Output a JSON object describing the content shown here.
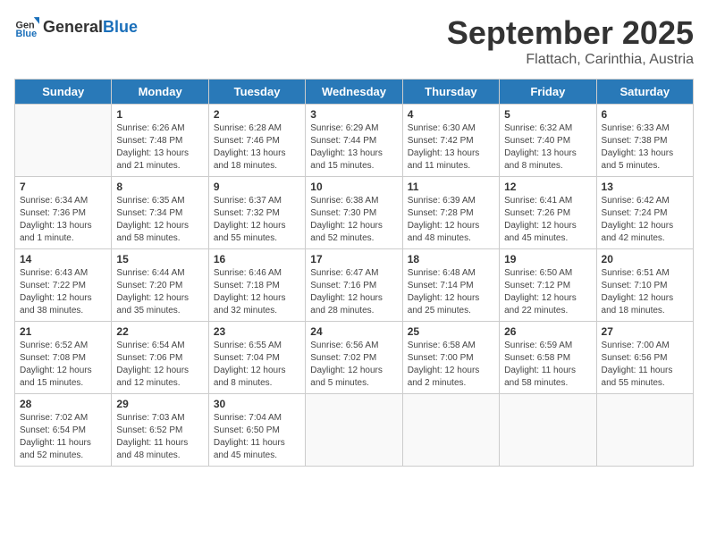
{
  "header": {
    "logo_general": "General",
    "logo_blue": "Blue",
    "month_year": "September 2025",
    "location": "Flattach, Carinthia, Austria"
  },
  "weekdays": [
    "Sunday",
    "Monday",
    "Tuesday",
    "Wednesday",
    "Thursday",
    "Friday",
    "Saturday"
  ],
  "weeks": [
    [
      {
        "day": "",
        "info": ""
      },
      {
        "day": "1",
        "info": "Sunrise: 6:26 AM\nSunset: 7:48 PM\nDaylight: 13 hours and 21 minutes."
      },
      {
        "day": "2",
        "info": "Sunrise: 6:28 AM\nSunset: 7:46 PM\nDaylight: 13 hours and 18 minutes."
      },
      {
        "day": "3",
        "info": "Sunrise: 6:29 AM\nSunset: 7:44 PM\nDaylight: 13 hours and 15 minutes."
      },
      {
        "day": "4",
        "info": "Sunrise: 6:30 AM\nSunset: 7:42 PM\nDaylight: 13 hours and 11 minutes."
      },
      {
        "day": "5",
        "info": "Sunrise: 6:32 AM\nSunset: 7:40 PM\nDaylight: 13 hours and 8 minutes."
      },
      {
        "day": "6",
        "info": "Sunrise: 6:33 AM\nSunset: 7:38 PM\nDaylight: 13 hours and 5 minutes."
      }
    ],
    [
      {
        "day": "7",
        "info": "Sunrise: 6:34 AM\nSunset: 7:36 PM\nDaylight: 13 hours and 1 minute."
      },
      {
        "day": "8",
        "info": "Sunrise: 6:35 AM\nSunset: 7:34 PM\nDaylight: 12 hours and 58 minutes."
      },
      {
        "day": "9",
        "info": "Sunrise: 6:37 AM\nSunset: 7:32 PM\nDaylight: 12 hours and 55 minutes."
      },
      {
        "day": "10",
        "info": "Sunrise: 6:38 AM\nSunset: 7:30 PM\nDaylight: 12 hours and 52 minutes."
      },
      {
        "day": "11",
        "info": "Sunrise: 6:39 AM\nSunset: 7:28 PM\nDaylight: 12 hours and 48 minutes."
      },
      {
        "day": "12",
        "info": "Sunrise: 6:41 AM\nSunset: 7:26 PM\nDaylight: 12 hours and 45 minutes."
      },
      {
        "day": "13",
        "info": "Sunrise: 6:42 AM\nSunset: 7:24 PM\nDaylight: 12 hours and 42 minutes."
      }
    ],
    [
      {
        "day": "14",
        "info": "Sunrise: 6:43 AM\nSunset: 7:22 PM\nDaylight: 12 hours and 38 minutes."
      },
      {
        "day": "15",
        "info": "Sunrise: 6:44 AM\nSunset: 7:20 PM\nDaylight: 12 hours and 35 minutes."
      },
      {
        "day": "16",
        "info": "Sunrise: 6:46 AM\nSunset: 7:18 PM\nDaylight: 12 hours and 32 minutes."
      },
      {
        "day": "17",
        "info": "Sunrise: 6:47 AM\nSunset: 7:16 PM\nDaylight: 12 hours and 28 minutes."
      },
      {
        "day": "18",
        "info": "Sunrise: 6:48 AM\nSunset: 7:14 PM\nDaylight: 12 hours and 25 minutes."
      },
      {
        "day": "19",
        "info": "Sunrise: 6:50 AM\nSunset: 7:12 PM\nDaylight: 12 hours and 22 minutes."
      },
      {
        "day": "20",
        "info": "Sunrise: 6:51 AM\nSunset: 7:10 PM\nDaylight: 12 hours and 18 minutes."
      }
    ],
    [
      {
        "day": "21",
        "info": "Sunrise: 6:52 AM\nSunset: 7:08 PM\nDaylight: 12 hours and 15 minutes."
      },
      {
        "day": "22",
        "info": "Sunrise: 6:54 AM\nSunset: 7:06 PM\nDaylight: 12 hours and 12 minutes."
      },
      {
        "day": "23",
        "info": "Sunrise: 6:55 AM\nSunset: 7:04 PM\nDaylight: 12 hours and 8 minutes."
      },
      {
        "day": "24",
        "info": "Sunrise: 6:56 AM\nSunset: 7:02 PM\nDaylight: 12 hours and 5 minutes."
      },
      {
        "day": "25",
        "info": "Sunrise: 6:58 AM\nSunset: 7:00 PM\nDaylight: 12 hours and 2 minutes."
      },
      {
        "day": "26",
        "info": "Sunrise: 6:59 AM\nSunset: 6:58 PM\nDaylight: 11 hours and 58 minutes."
      },
      {
        "day": "27",
        "info": "Sunrise: 7:00 AM\nSunset: 6:56 PM\nDaylight: 11 hours and 55 minutes."
      }
    ],
    [
      {
        "day": "28",
        "info": "Sunrise: 7:02 AM\nSunset: 6:54 PM\nDaylight: 11 hours and 52 minutes."
      },
      {
        "day": "29",
        "info": "Sunrise: 7:03 AM\nSunset: 6:52 PM\nDaylight: 11 hours and 48 minutes."
      },
      {
        "day": "30",
        "info": "Sunrise: 7:04 AM\nSunset: 6:50 PM\nDaylight: 11 hours and 45 minutes."
      },
      {
        "day": "",
        "info": ""
      },
      {
        "day": "",
        "info": ""
      },
      {
        "day": "",
        "info": ""
      },
      {
        "day": "",
        "info": ""
      }
    ]
  ]
}
